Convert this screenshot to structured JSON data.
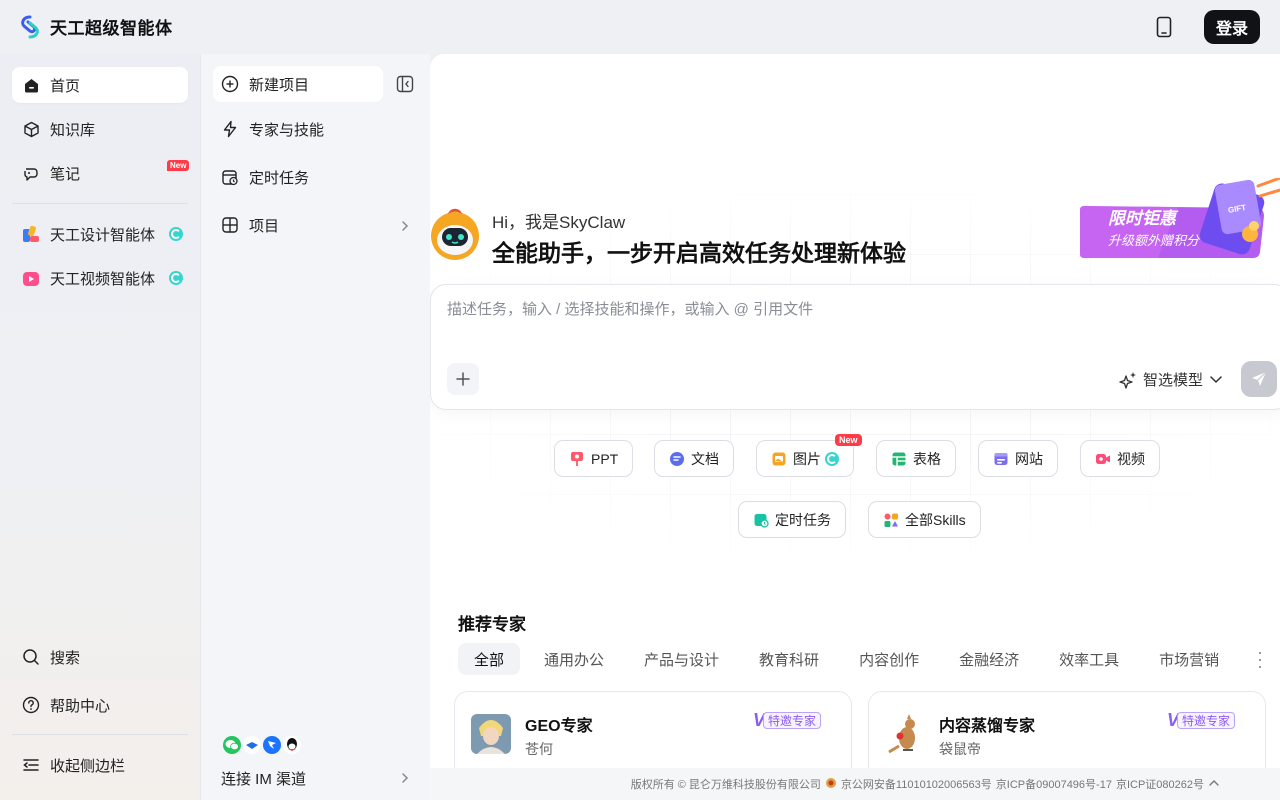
{
  "app": {
    "name": "天工超级智能体",
    "login_label": "登录"
  },
  "leftnav": {
    "items": [
      {
        "label": "首页",
        "icon": "home-icon"
      },
      {
        "label": "知识库",
        "icon": "cube-icon"
      },
      {
        "label": "笔记",
        "icon": "note-icon",
        "badge": "New"
      },
      {
        "label": "天工设计智能体",
        "icon": "design-agent-icon"
      },
      {
        "label": "天工视频智能体",
        "icon": "video-agent-icon"
      }
    ],
    "bottom": [
      {
        "label": "搜索",
        "icon": "search-icon"
      },
      {
        "label": "帮助中心",
        "icon": "help-icon"
      },
      {
        "label": "收起侧边栏",
        "icon": "collapse-sidebar-icon"
      }
    ]
  },
  "panel2": {
    "items": [
      {
        "label": "新建项目"
      },
      {
        "label": "专家与技能"
      },
      {
        "label": "定时任务"
      },
      {
        "label": "项目"
      }
    ],
    "im_label": "连接 IM 渠道"
  },
  "hero": {
    "greeting": "Hi，我是SkyClaw",
    "headline": "全能助手，一步开启高效任务处理新体验",
    "promo_main": "限时钜惠",
    "promo_sub": "升级额外赠积分",
    "promo_gift": "GIFT"
  },
  "input": {
    "placeholder": "描述任务，输入 / 选择技能和操作，或输入 @ 引用文件",
    "model_label": "智选模型"
  },
  "quick_actions": {
    "row1": [
      {
        "label": "PPT",
        "color": "#ff5a6a"
      },
      {
        "label": "文档",
        "color": "#5b6cf0"
      },
      {
        "label": "图片",
        "color": "#f5a524",
        "badge": "New"
      },
      {
        "label": "表格",
        "color": "#22b573"
      },
      {
        "label": "网站",
        "color": "#7c6cf0"
      },
      {
        "label": "视频",
        "color": "#ff4d7a"
      }
    ],
    "row2": [
      {
        "label": "定时任务",
        "color": "#17c3a3"
      },
      {
        "label": "全部Skills",
        "color": "#ff5a6a"
      }
    ]
  },
  "experts": {
    "title": "推荐专家",
    "tabs": [
      "全部",
      "通用办公",
      "产品与设计",
      "教育科研",
      "内容创作",
      "金融经济",
      "效率工具",
      "市场营销"
    ],
    "cards": [
      {
        "title": "GEO专家",
        "author": "苍何",
        "badge": "特邀专家"
      },
      {
        "title": "内容蒸馏专家",
        "author": "袋鼠帝",
        "badge": "特邀专家"
      }
    ]
  },
  "footer": {
    "copyright": "版权所有 © 昆仑万维科技股份有限公司",
    "police": "京公网安备11010102006563号",
    "icp": "京ICP备09007496号-17",
    "icp_license": "京ICP证080262号"
  }
}
